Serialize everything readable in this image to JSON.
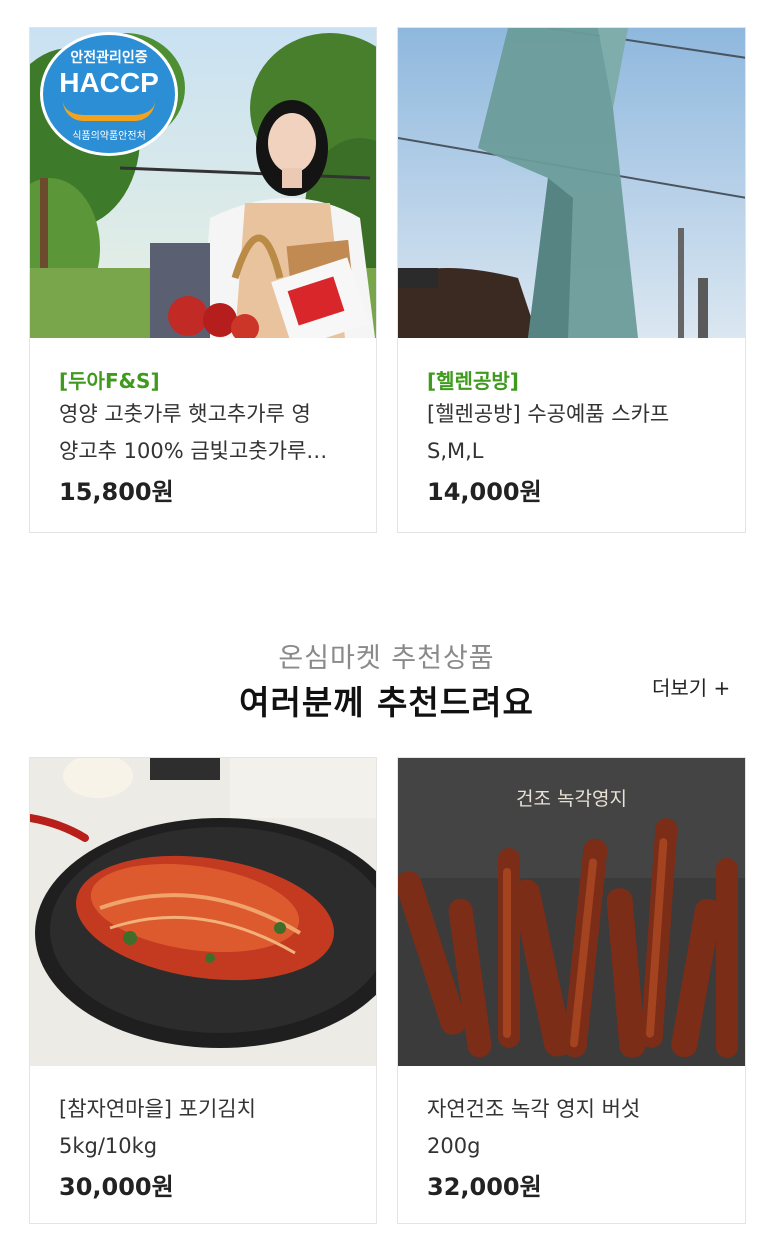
{
  "products_top": [
    {
      "shop": "[두아F&S]",
      "name_line1": "영양 고춧가루 햇고추가루 영",
      "name_line2": "양고추 100% 금빛고춧가루…",
      "price": "15,800원",
      "badge": {
        "top": "안전관리인증",
        "main": "HACCP",
        "bottom": "식품의약품안전처"
      }
    },
    {
      "shop": "[헬렌공방]",
      "name_line1": "[헬렌공방] 수공예품 스카프",
      "name_line2": "S,M,L",
      "price": "14,000원"
    }
  ],
  "section": {
    "subtitle": "온심마켓 추천상품",
    "title": "여러분께 추천드려요",
    "more": "더보기 +"
  },
  "products_bottom": [
    {
      "name_line1": "[참자연마을] 포기김치",
      "name_line2": "5kg/10kg",
      "price": "30,000원"
    },
    {
      "name_line1": "자연건조 녹각 영지 버섯",
      "name_line2": "200g",
      "price": "32,000원",
      "image_caption": "건조 녹각영지"
    }
  ],
  "colors": {
    "shop_green": "#3f9a1e",
    "border": "#e4e4e4"
  }
}
